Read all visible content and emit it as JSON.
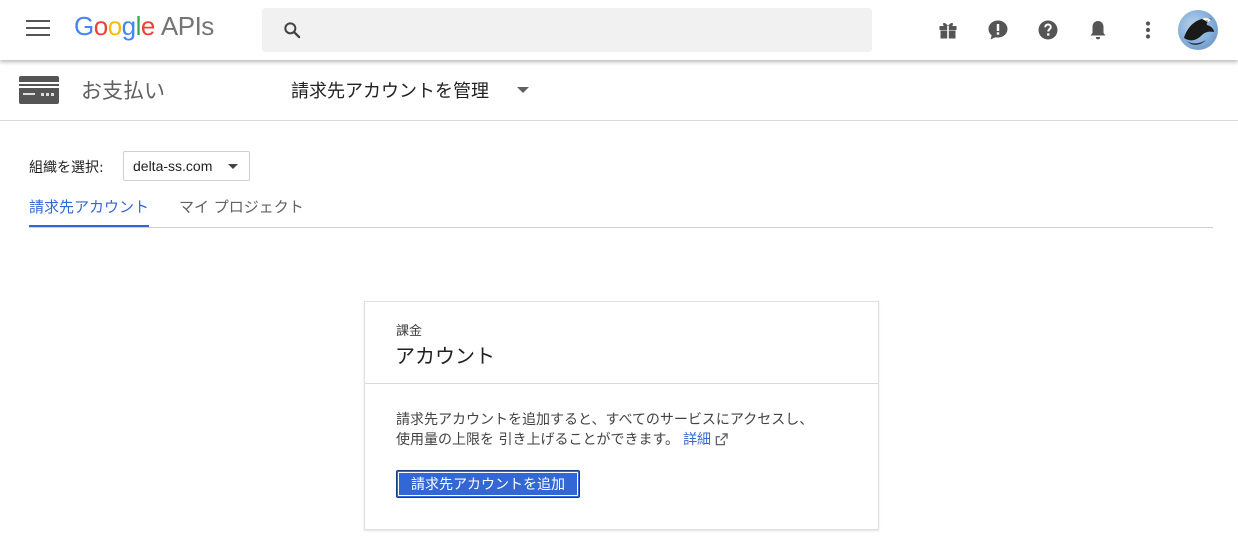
{
  "header": {
    "logo_google": [
      "G",
      "o",
      "o",
      "g",
      "l",
      "e"
    ],
    "logo_suffix": "APIs",
    "search_placeholder": "",
    "icons": [
      "menu-icon",
      "search-icon",
      "gift-icon",
      "feedback-icon",
      "help-icon",
      "notifications-icon",
      "more-vert-icon"
    ]
  },
  "subheader": {
    "page_title": "お支払い",
    "manage_label": "請求先アカウントを管理"
  },
  "org": {
    "label": "組織を選択:",
    "selected": "delta-ss.com"
  },
  "tabs": [
    {
      "label": "請求先アカウント",
      "active": true
    },
    {
      "label": "マイ プロジェクト",
      "active": false
    }
  ],
  "card": {
    "kicker": "課金",
    "title": "アカウント",
    "desc_line1": "請求先アカウントを追加すると、すべてのサービスにアクセスし、",
    "desc_line2": "使用量の上限を 引き上げることができます。",
    "more_link": "詳細",
    "add_button": "請求先アカウントを追加"
  },
  "colors": {
    "accent": "#3367d6",
    "google_blue": "#4285F4",
    "google_red": "#EA4335",
    "google_yellow": "#FBBC05",
    "google_green": "#34A853"
  }
}
